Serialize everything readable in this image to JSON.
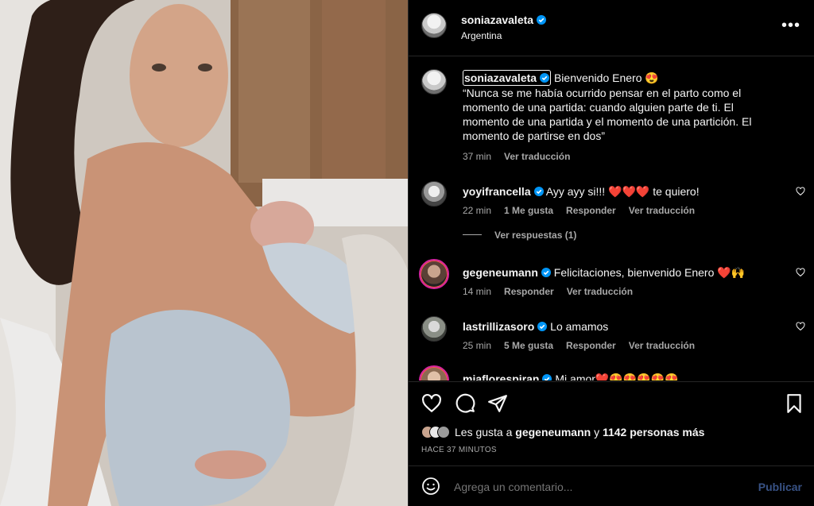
{
  "post": {
    "username": "soniazavaleta",
    "location": "Argentina",
    "more_label": "•••"
  },
  "caption": {
    "username": "soniazavaleta",
    "text": "Bienvenido Enero 😍",
    "quote": "“Nunca se me había ocurrido pensar en el parto como el momento de una partida: cuando alguien parte de ti. El momento de una partida y el momento de una partición. El momento de partirse en dos”",
    "time": "37 min",
    "translate": "Ver traducción"
  },
  "comments": [
    {
      "username": "yoyifrancella",
      "text": "Ayy ayy si!!! ❤️❤️❤️ te quiero!",
      "time": "22 min",
      "likes": "1 Me gusta",
      "reply": "Responder",
      "translate": "Ver traducción"
    },
    {
      "username": "gegeneumann",
      "text": "Felicitaciones, bienvenido Enero ❤️🙌",
      "time": "14 min",
      "likes": "",
      "reply": "Responder",
      "translate": "Ver traducción"
    },
    {
      "username": "lastrillizasoro",
      "text": "Lo amamos",
      "time": "25 min",
      "likes": "5 Me gusta",
      "reply": "Responder",
      "translate": "Ver traducción"
    },
    {
      "username": "miaflorespiran",
      "text": "Mi amor❤️😍😍😍😍😍",
      "time": "",
      "likes": "",
      "reply": "",
      "translate": ""
    }
  ],
  "view_replies": "Ver respuestas (1)",
  "likes": {
    "prefix": "Les gusta a",
    "user": "gegeneumann",
    "middle": "y",
    "count": "1142 personas más"
  },
  "timestamp": "HACE 37 MINUTOS",
  "add_comment": {
    "placeholder": "Agrega un comentario...",
    "publish": "Publicar"
  },
  "colors": {
    "background": "#000000",
    "verified": "#0095f6",
    "muted": "#a8a8a8",
    "publish_disabled": "#385285"
  }
}
